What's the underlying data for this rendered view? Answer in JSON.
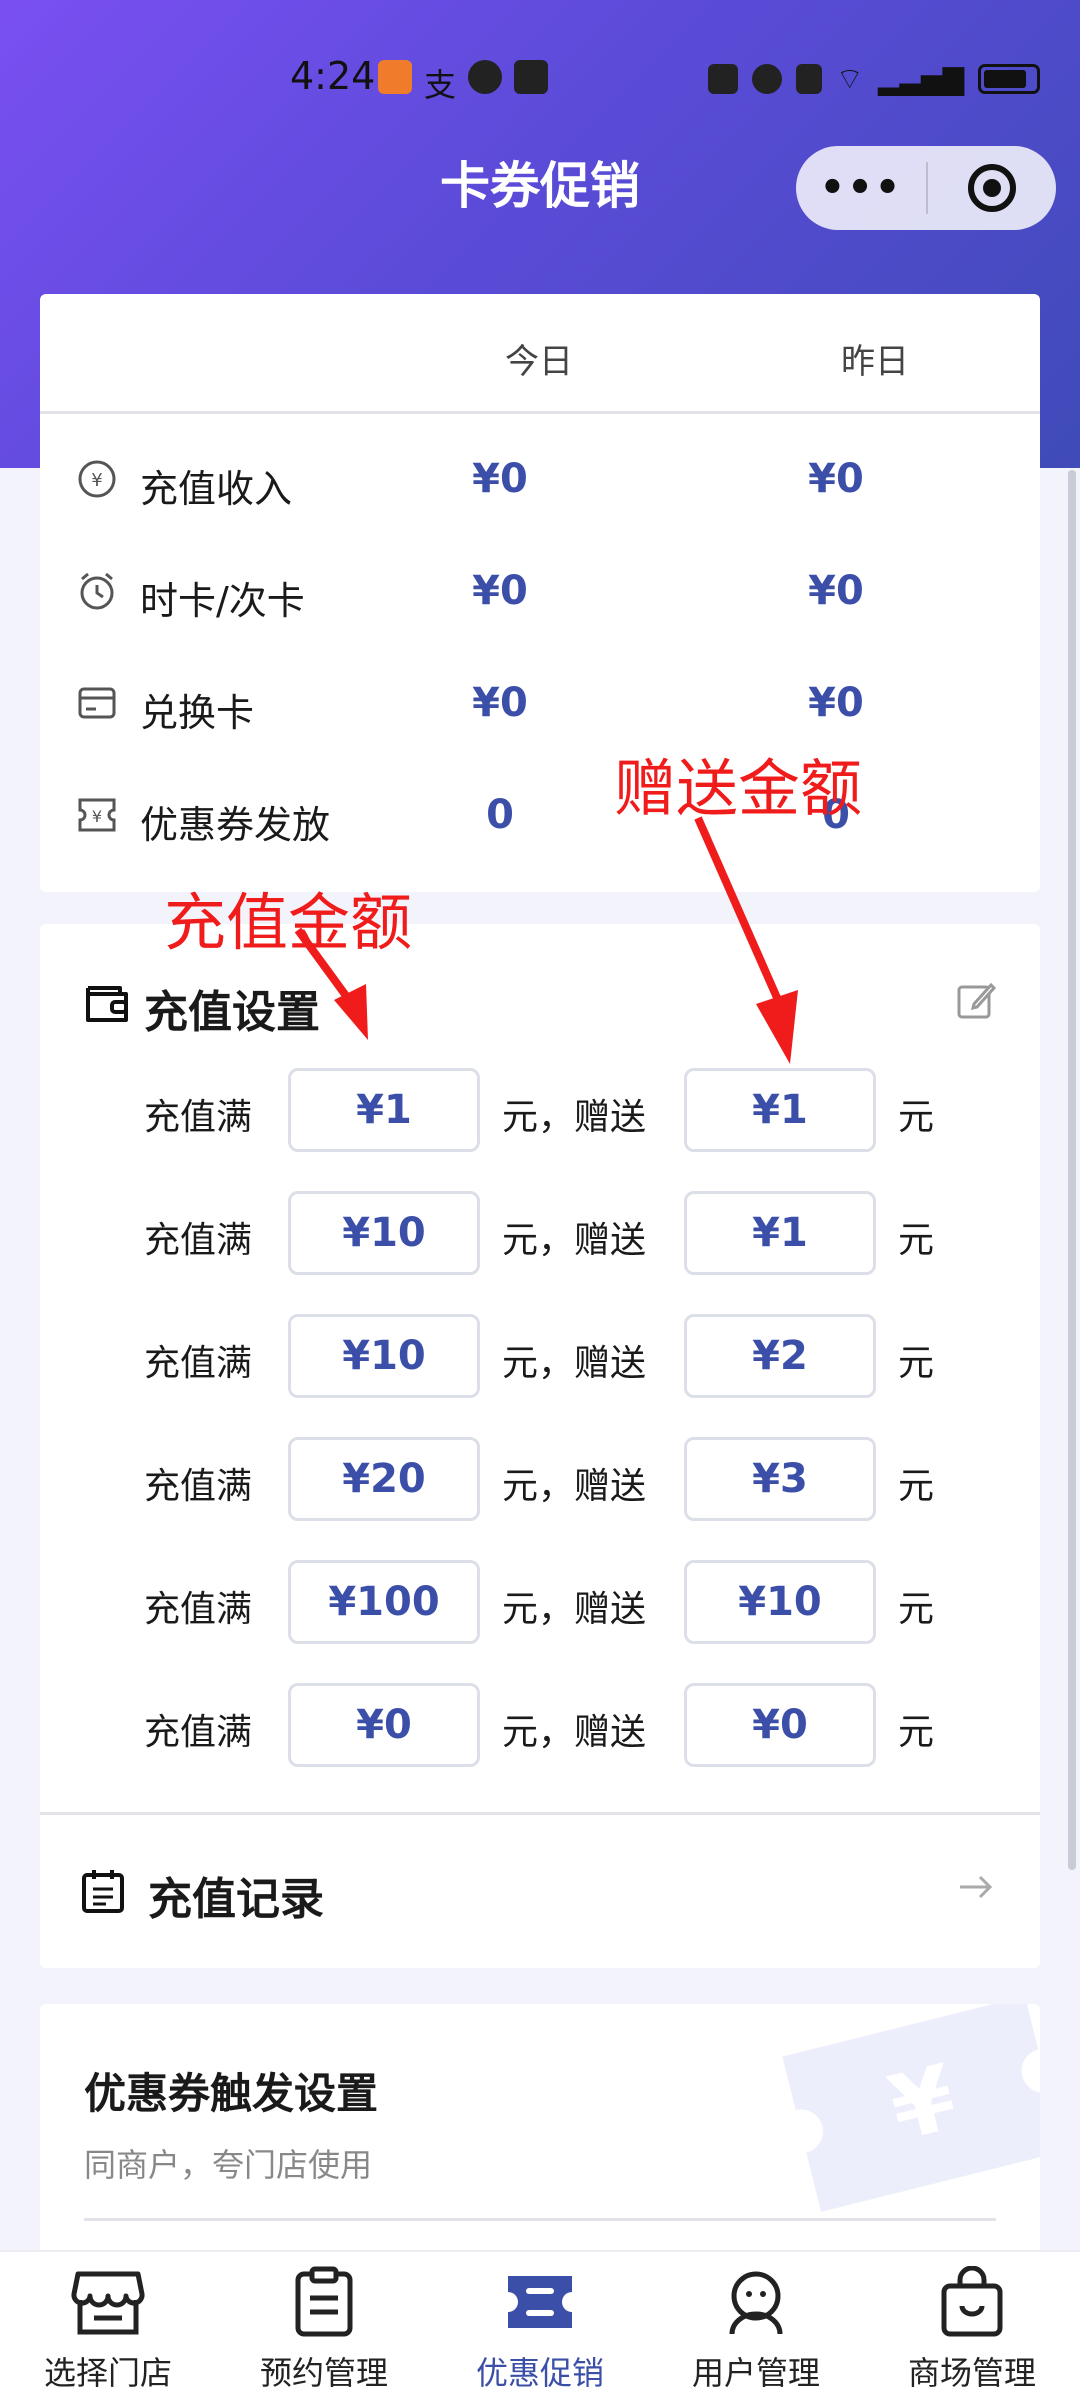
{
  "status_bar": {
    "time": "4:24"
  },
  "nav": {
    "title": "卡券促销"
  },
  "stats": {
    "columns": [
      "今日",
      "昨日"
    ],
    "rows": [
      {
        "label": "充值收入",
        "icon": "yuan-circle-icon",
        "today": "¥0",
        "yesterday": "¥0"
      },
      {
        "label": "时卡/次卡",
        "icon": "alarm-clock-icon",
        "today": "¥0",
        "yesterday": "¥0"
      },
      {
        "label": "兑换卡",
        "icon": "card-icon",
        "today": "¥0",
        "yesterday": "¥0"
      },
      {
        "label": "优惠券发放",
        "icon": "coupon-icon",
        "today": "0",
        "yesterday": "0"
      }
    ]
  },
  "recharge": {
    "title": "充值设置",
    "row_label": "充值满",
    "mid_text": "元，赠送",
    "unit": "元",
    "rules": [
      {
        "amount": "¥1",
        "bonus": "¥1"
      },
      {
        "amount": "¥10",
        "bonus": "¥1"
      },
      {
        "amount": "¥10",
        "bonus": "¥2"
      },
      {
        "amount": "¥20",
        "bonus": "¥3"
      },
      {
        "amount": "¥100",
        "bonus": "¥10"
      },
      {
        "amount": "¥0",
        "bonus": "¥0"
      }
    ],
    "records_label": "充值记录"
  },
  "coupon": {
    "title": "优惠券触发设置",
    "subtitle": "同商户，夸门店使用"
  },
  "annotations": {
    "recharge_amount": "充值金额",
    "bonus_amount": "赠送金额"
  },
  "tabs": [
    {
      "label": "选择门店",
      "icon": "store-icon",
      "active": false
    },
    {
      "label": "预约管理",
      "icon": "clipboard-icon",
      "active": false
    },
    {
      "label": "优惠促销",
      "icon": "promotion-icon",
      "active": true
    },
    {
      "label": "用户管理",
      "icon": "user-icon",
      "active": false
    },
    {
      "label": "商场管理",
      "icon": "shopping-bag-icon",
      "active": false
    }
  ],
  "colors": {
    "accent": "#3c4fa8",
    "header_start": "#7a4ff2",
    "header_end": "#3f4bb8",
    "annotation": "#f01c1c"
  }
}
